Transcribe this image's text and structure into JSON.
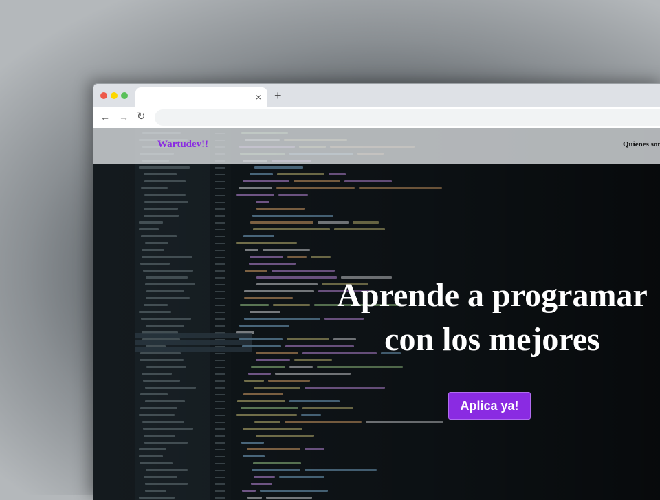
{
  "browser": {
    "tab_title": "",
    "tab_close_label": "×",
    "new_tab_label": "+",
    "back_label": "←",
    "forward_label": "→",
    "reload_label": "↻",
    "address": ""
  },
  "site": {
    "brand": "Wartudev!!",
    "nav_link": "Quienes somos",
    "hero_line_1": "Aprende a programar",
    "hero_line_2": "con los mejores",
    "cta_label": "Aplica ya!"
  },
  "colors": {
    "brand": "#8a2be2",
    "cta_background": "#8a2be2",
    "hero_text": "#ffffff",
    "navbar": "#d7dadd"
  },
  "icons": {
    "window_controls": [
      "close-dot",
      "minimize-dot",
      "maximize-dot"
    ],
    "toolbar": [
      "back-arrow-icon",
      "forward-arrow-icon",
      "reload-icon"
    ]
  }
}
